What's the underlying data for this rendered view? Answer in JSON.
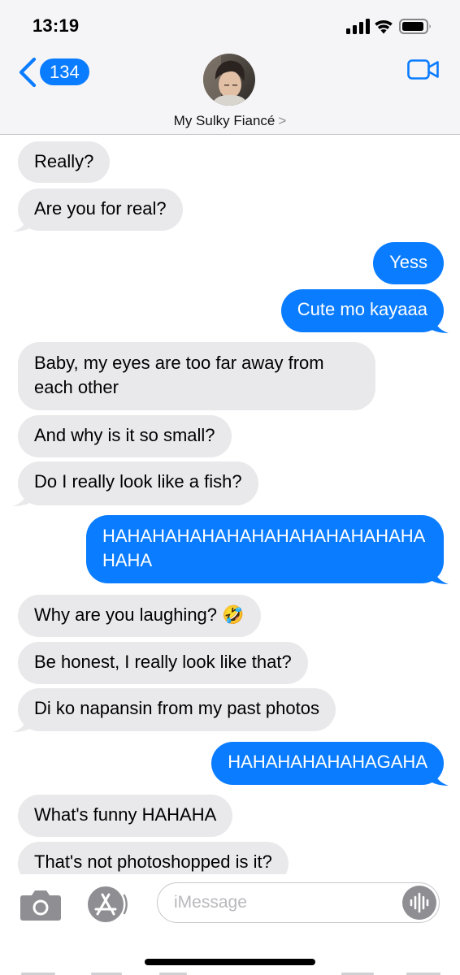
{
  "status_bar": {
    "time": "13:19"
  },
  "header": {
    "back_count": "134",
    "contact_name": "My Sulky Fiancé",
    "contact_chevron": ">"
  },
  "messages": [
    {
      "direction": "incoming",
      "text": "Really?"
    },
    {
      "direction": "incoming",
      "text": "Are you for real?"
    },
    {
      "direction": "outgoing",
      "text": "Yess"
    },
    {
      "direction": "outgoing",
      "text": "Cute mo kayaaa"
    },
    {
      "direction": "incoming",
      "text": "Baby, my eyes are too far away from each other"
    },
    {
      "direction": "incoming",
      "text": "And why is it so small?"
    },
    {
      "direction": "incoming",
      "text": "Do I really look like a fish?"
    },
    {
      "direction": "outgoing",
      "text": "HAHAHAHAHAHAHAHAHAHAHAHAHAHAHA"
    },
    {
      "direction": "incoming",
      "text": "Why are you laughing? 🤣"
    },
    {
      "direction": "incoming",
      "text": "Be honest, I really look like that?"
    },
    {
      "direction": "incoming",
      "text": "Di ko napansin from my past photos"
    },
    {
      "direction": "outgoing",
      "text": "HAHAHAHAHAHAGAHA"
    },
    {
      "direction": "incoming",
      "text": "What's funny HAHAHA"
    },
    {
      "direction": "incoming",
      "text": "That's not photoshopped is it?"
    }
  ],
  "composer": {
    "placeholder": "iMessage"
  },
  "icons": {
    "back": "chevron-left-icon",
    "video": "video-camera-icon",
    "camera": "camera-icon",
    "apps": "app-store-icon",
    "audio": "audio-waveform-icon"
  },
  "colors": {
    "accent": "#0a7cff",
    "incoming_bubble": "#e9e9eb",
    "header_bg": "#f5f5f7"
  }
}
